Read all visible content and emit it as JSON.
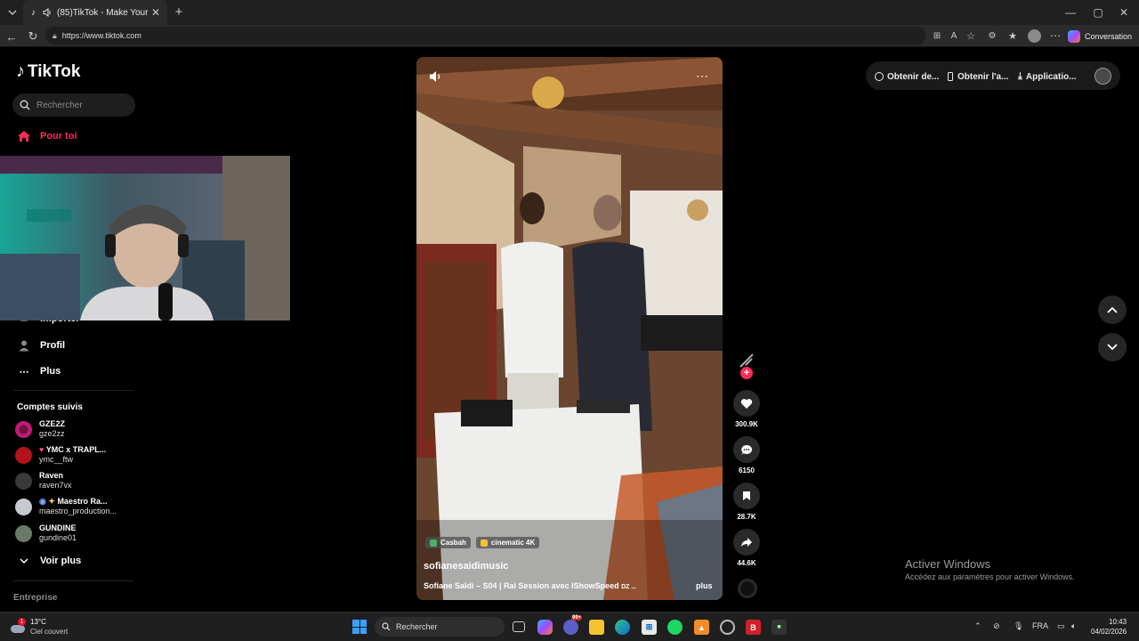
{
  "browser": {
    "tab_title": "(85)TikTok - Make Your Day",
    "url": "https://www.tiktok.com",
    "copilot_label": "Conversation"
  },
  "sidebar": {
    "logo": "TikTok",
    "search_placeholder": "Rechercher",
    "nav": {
      "for_you": "Pour toi",
      "import": "Importer",
      "profile": "Profil",
      "more": "Plus"
    },
    "following_title": "Comptes suivis",
    "accounts": [
      {
        "name": "GZE2Z",
        "handle": "gze2zz",
        "color": "#c2187a"
      },
      {
        "name": "YMC x TRAPL...",
        "handle": "ymc__ftw",
        "color": "#b3121b"
      },
      {
        "name": "Raven",
        "handle": "raven7vx",
        "color": "#3a3a3a"
      },
      {
        "name": "Maestro Ra...",
        "handle": "maestro_production...",
        "color": "#c8c8d0"
      },
      {
        "name": "GUNDINE",
        "handle": "gundine01",
        "color": "#6a7a6a"
      }
    ],
    "see_more": "Voir plus",
    "company": "Entreprise"
  },
  "video": {
    "tags": [
      "Casbah",
      "cinematic 4K"
    ],
    "author": "sofianesaidimusic",
    "caption": "Sofiane Saïdi – S04 | Rai Session avec IShowSpeed",
    "caption_tail": "DZ ...",
    "more": "plus"
  },
  "actions": {
    "likes": "300.9K",
    "comments": "6150",
    "saves": "28.7K",
    "shares": "44.6K"
  },
  "topbar": {
    "btn1": "Obtenir de...",
    "btn2": "Obtenir l'a...",
    "btn3": "Applicatio..."
  },
  "watermark": {
    "title": "Activer Windows",
    "subtitle": "Accédez aux paramètres pour activer Windows."
  },
  "taskbar": {
    "weather_temp": "13°C",
    "weather_desc": "Ciel couvert",
    "weather_badge": "1",
    "search": "Rechercher",
    "lang": "FRA",
    "time": "10:43",
    "date": "04/02/2026",
    "chat_badge": "99+"
  },
  "colors": {
    "accent": "#fe2c55",
    "bg": "#000000"
  }
}
